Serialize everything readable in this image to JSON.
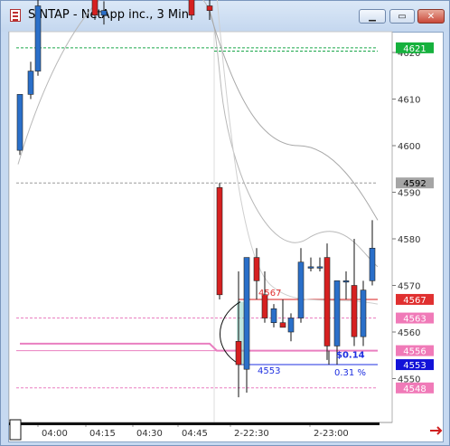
{
  "window": {
    "title": "S.NTAP - NetApp inc., 3 Min",
    "minimize_icon": "minimize-icon",
    "maximize_icon": "maximize-icon",
    "close_icon": "close-icon"
  },
  "colors": {
    "up": "#2a6fc9",
    "down": "#d62020",
    "pivot_green": "#1aa64a",
    "pink_line": "#e97fc0",
    "red_line": "#d81e1e",
    "blue_line": "#1e2fe0",
    "gray_line": "#a0a0a0"
  },
  "chart_data": {
    "type": "candlestick",
    "symbol": "S.NTAP",
    "interval": "3 Min",
    "y_ticks": [
      4550,
      4560,
      4570,
      4580,
      4590,
      4600,
      4610,
      4620
    ],
    "ylim": [
      4540,
      4633
    ],
    "x_ticks": [
      "04:00",
      "04:15",
      "04:30",
      "04:45",
      "2-22:30",
      "2-23:00"
    ],
    "price_labels": [
      {
        "value": 4621,
        "text": "4621",
        "bg": "#16b13d",
        "fg": "#ffffff"
      },
      {
        "value": 4592,
        "text": "4592",
        "bg": "#a5a5a5",
        "fg": "#000000"
      },
      {
        "value": 4567,
        "text": "4567",
        "bg": "#e03030",
        "fg": "#ffffff"
      },
      {
        "value": 4563,
        "text": "4563",
        "bg": "#f07ab8",
        "fg": "#ffffff"
      },
      {
        "value": 4556,
        "text": "4556",
        "bg": "#f07ab8",
        "fg": "#ffffff"
      },
      {
        "value": 4553,
        "text": "4553",
        "bg": "#1212d8",
        "fg": "#ffffff"
      },
      {
        "value": 4548,
        "text": "4548",
        "bg": "#f07ab8",
        "fg": "#ffffff"
      }
    ],
    "horizontal_lines": [
      {
        "name": "green-level",
        "value": 4621,
        "color": "#1aa64a",
        "dash": true
      },
      {
        "name": "gray-level",
        "value": 4592,
        "color": "#9a9a9a",
        "dash": true
      },
      {
        "name": "red-level",
        "value": 4567,
        "color": "#d81e1e",
        "dash": false
      },
      {
        "name": "pink-level-upper",
        "value": 4563,
        "color": "#e97fc0",
        "dash": true
      },
      {
        "name": "pink-level-mid",
        "value": 4556,
        "color": "#e97fc0",
        "dash": false
      },
      {
        "name": "blue-level",
        "value": 4553,
        "color": "#1e2fe0",
        "dash": false
      },
      {
        "name": "pink-level-lower",
        "value": 4548,
        "color": "#e97fc0",
        "dash": true
      }
    ],
    "candles": [
      {
        "x": 22,
        "o": 4599,
        "h": 4611,
        "l": 4598,
        "c": 4611
      },
      {
        "x": 34,
        "o": 4611,
        "h": 4618,
        "l": 4610,
        "c": 4616
      },
      {
        "x": 42,
        "o": 4616,
        "h": 4633,
        "l": 4615,
        "c": 4630
      },
      {
        "x": 105,
        "o": 4633,
        "h": 4634,
        "l": 4627,
        "c": 4628
      },
      {
        "x": 115,
        "o": 4628,
        "h": 4631,
        "l": 4626,
        "c": 4629
      },
      {
        "x": 212,
        "o": 4633,
        "h": 4634,
        "l": 4627,
        "c": 4628
      },
      {
        "x": 232,
        "o": 4630,
        "h": 4632,
        "l": 4627,
        "c": 4629
      },
      {
        "x": 243,
        "o": 4591,
        "h": 4592,
        "l": 4567,
        "c": 4568
      },
      {
        "x": 264,
        "o": 4558,
        "h": 4573,
        "l": 4546,
        "c": 4553
      },
      {
        "x": 273,
        "o": 4552,
        "h": 4576,
        "l": 4547,
        "c": 4576
      },
      {
        "x": 284,
        "o": 4576,
        "h": 4578,
        "l": 4567,
        "c": 4571
      },
      {
        "x": 293,
        "o": 4568,
        "h": 4573,
        "l": 4562,
        "c": 4563
      },
      {
        "x": 303,
        "o": 4562,
        "h": 4566,
        "l": 4561,
        "c": 4565
      },
      {
        "x": 313,
        "o": 4562,
        "h": 4567,
        "l": 4561,
        "c": 4561
      },
      {
        "x": 322,
        "o": 4560,
        "h": 4564,
        "l": 4558,
        "c": 4563
      },
      {
        "x": 333,
        "o": 4563,
        "h": 4578,
        "l": 4562,
        "c": 4575
      },
      {
        "x": 344,
        "o": 4574,
        "h": 4576,
        "l": 4573,
        "c": 4574
      },
      {
        "x": 354,
        "o": 4574,
        "h": 4576,
        "l": 4573,
        "c": 4574
      },
      {
        "x": 362,
        "o": 4576,
        "h": 4579,
        "l": 4554,
        "c": 4557
      },
      {
        "x": 373,
        "o": 4557,
        "h": 4571,
        "l": 4553,
        "c": 4571
      },
      {
        "x": 383,
        "o": 4571,
        "h": 4573,
        "l": 4567,
        "c": 4571
      },
      {
        "x": 392,
        "o": 4570,
        "h": 4580,
        "l": 4557,
        "c": 4559
      },
      {
        "x": 402,
        "o": 4559,
        "h": 4571,
        "l": 4557,
        "c": 4569
      },
      {
        "x": 412,
        "o": 4571,
        "h": 4584,
        "l": 4570,
        "c": 4578
      }
    ],
    "annotations": [
      {
        "text": "4567",
        "color": "#e03030"
      },
      {
        "text": "4553",
        "color": "#1e2fe0"
      },
      {
        "text": "$0.14",
        "color": "#1e2fe0"
      },
      {
        "text": "0.31 %",
        "color": "#1e2fe0"
      }
    ]
  }
}
